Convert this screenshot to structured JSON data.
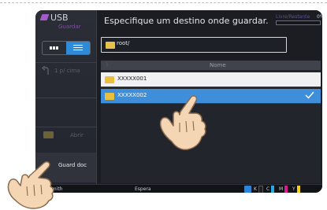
{
  "header": {
    "app_title": "USB",
    "app_subtitle": "Guardar",
    "prompt": "Especifique um destino onde guardar.",
    "capacity_label": "Livre/Restante",
    "capacity_value": "0%",
    "capacity_fraction": 0.0
  },
  "sidebar": {
    "up_label": "1 p/ cima",
    "open_label": "Abrir",
    "save_label": "Guard doc"
  },
  "path": {
    "current": "root/"
  },
  "table": {
    "column_name": "Nome",
    "sort_indicator": "1",
    "rows": [
      {
        "name": "XXXXX001",
        "selected": false
      },
      {
        "name": "XXXXX002",
        "selected": true
      }
    ]
  },
  "statusbar": {
    "user": "Smith",
    "status": "Espera",
    "toner": [
      {
        "label": "K",
        "color": "#1f1f1f"
      },
      {
        "label": "C",
        "color": "#2aa7e1"
      },
      {
        "label": "M",
        "color": "#d81b8c"
      },
      {
        "label": "Y",
        "color": "#f2d21b"
      }
    ]
  },
  "colors": {
    "accent": "#2d8bd9",
    "selected_row": "#3e8ed9",
    "usb_purple": "#a35acb",
    "folder": "#e9bf3e"
  },
  "icons": [
    "usb-icon",
    "list-view-icon",
    "detail-view-icon",
    "up-arrow-icon",
    "folder-icon",
    "check-icon",
    "tap-hand-icon"
  ]
}
